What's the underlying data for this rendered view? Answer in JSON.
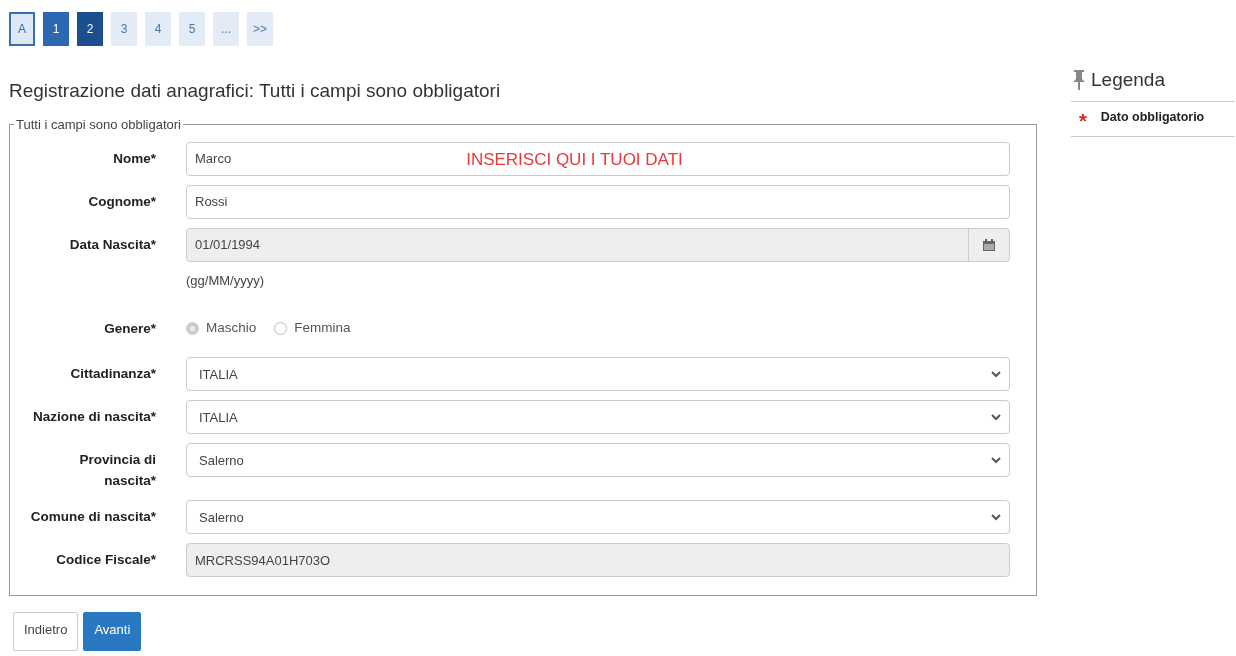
{
  "pagination": [
    {
      "label": "A",
      "kind": "letter",
      "selected": false
    },
    {
      "label": "1",
      "kind": "done",
      "selected": false
    },
    {
      "label": "2",
      "kind": "done",
      "selected": true
    },
    {
      "label": "3",
      "kind": "todo",
      "selected": false
    },
    {
      "label": "4",
      "kind": "todo",
      "selected": false
    },
    {
      "label": "5",
      "kind": "todo",
      "selected": false
    },
    {
      "label": "...",
      "kind": "todo",
      "selected": false
    },
    {
      "label": ">>",
      "kind": "todo",
      "selected": false
    }
  ],
  "title": "Registrazione dati anagrafici: Tutti i campi sono obbligatori",
  "fieldset": {
    "legend": "Tutti i campi sono obbligatori",
    "annotation": "INSERISCI QUI I TUOI DATI",
    "fields": [
      {
        "kind": "text",
        "label": "Nome*",
        "value": "Marco",
        "disabled": false
      },
      {
        "kind": "text",
        "label": "Cognome*",
        "value": "Rossi",
        "disabled": false
      },
      {
        "kind": "date",
        "label": "Data Nascita*",
        "value": "01/01/1994",
        "hint": "(gg/MM/yyyy)",
        "disabled": true
      },
      {
        "kind": "radio",
        "label": "Genere*",
        "disabled": true,
        "options": [
          {
            "label": "Maschio",
            "selected": true
          },
          {
            "label": "Femmina",
            "selected": false
          }
        ]
      },
      {
        "kind": "select",
        "label": "Cittadinanza*",
        "value": "ITALIA"
      },
      {
        "kind": "select",
        "label": "Nazione di nascita*",
        "value": "ITALIA"
      },
      {
        "kind": "select",
        "label": "Provincia di nascita*",
        "value": "Salerno"
      },
      {
        "kind": "select",
        "label": "Comune di nascita*",
        "value": "Salerno"
      },
      {
        "kind": "text",
        "label": "Codice Fiscale*",
        "value": "MRCRSS94A01H703O",
        "disabled": true
      }
    ]
  },
  "buttons": [
    {
      "label": "Indietro",
      "kind": "secondary"
    },
    {
      "label": "Avanti",
      "kind": "primary"
    }
  ],
  "legend_panel": {
    "title": "Legenda",
    "items": [
      {
        "symbol": "*",
        "label": "Dato obbligatorio"
      }
    ]
  }
}
